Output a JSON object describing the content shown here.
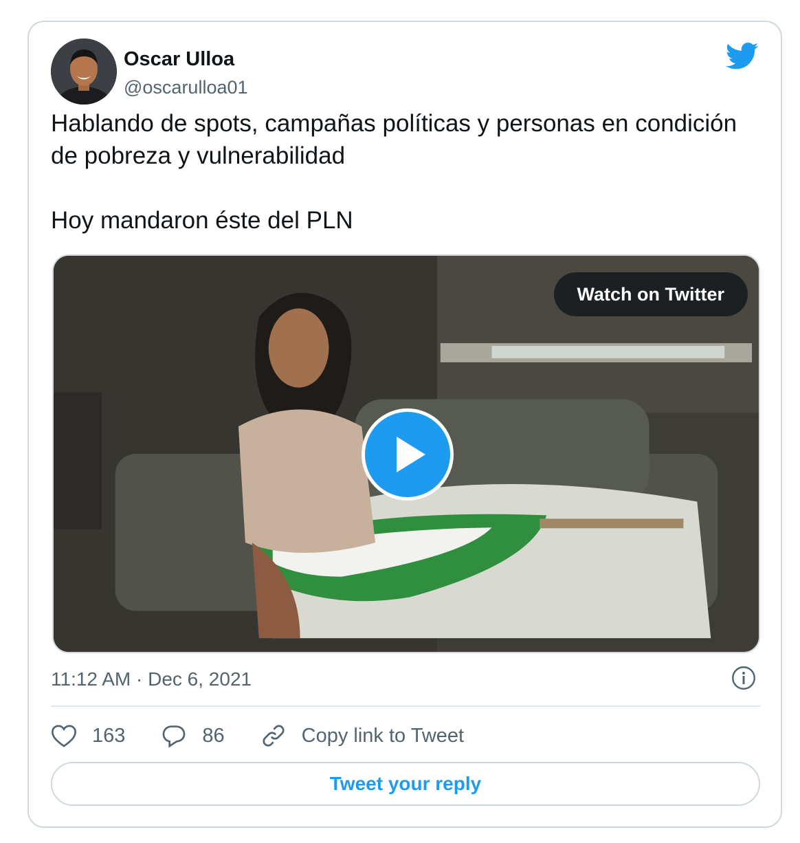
{
  "author": {
    "name": "Oscar Ulloa",
    "handle": "@oscarulloa01",
    "avatar_icon": "profile-photo"
  },
  "logo_icon": "twitter-bird-icon",
  "tweet": {
    "text": "Hablando de spots, campañas políticas y personas en condición de pobreza y vulnerabilidad\n\nHoy mandaron éste del PLN"
  },
  "media": {
    "watch_label": "Watch on Twitter",
    "play_icon": "play-icon"
  },
  "meta": {
    "timestamp": "11:12 AM · Dec 6, 2021",
    "info_icon": "info-icon"
  },
  "actions": {
    "likes": "163",
    "replies": "86",
    "copy_link_label": "Copy link to Tweet"
  },
  "reply_button_label": "Tweet your reply",
  "colors": {
    "accent": "#1d9bf0",
    "secondary_text": "#536471",
    "border": "#cfd9de"
  }
}
